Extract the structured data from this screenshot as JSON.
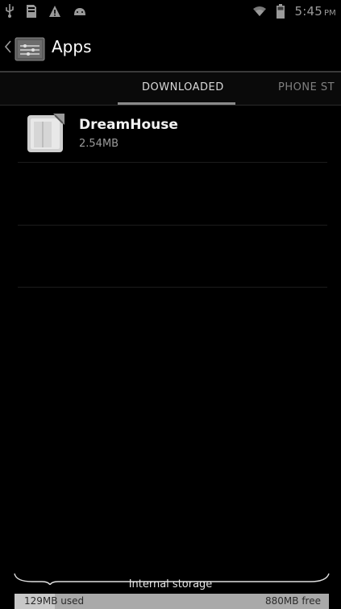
{
  "status_bar": {
    "time": "5:45",
    "ampm": "PM",
    "icons": [
      "usb-icon",
      "sd-card-icon",
      "warning-icon",
      "android-icon",
      "wifi-icon",
      "battery-icon"
    ]
  },
  "action_bar": {
    "title": "Apps",
    "icon": "settings-app-icon"
  },
  "tabs": [
    {
      "label": "DOWNLOADED",
      "selected": true
    },
    {
      "label": "PHONE ST",
      "selected": false
    }
  ],
  "apps": [
    {
      "name": "DreamHouse",
      "size": "2.54MB",
      "icon": "app-package-icon"
    }
  ],
  "storage": {
    "label": "Internal storage",
    "used": "129MB used",
    "free": "880MB free",
    "used_fraction": 0.128
  },
  "colors": {
    "background": "#000000",
    "tab_indicator": "#8a8a8a",
    "storage_bar": "#a9a9a9"
  }
}
